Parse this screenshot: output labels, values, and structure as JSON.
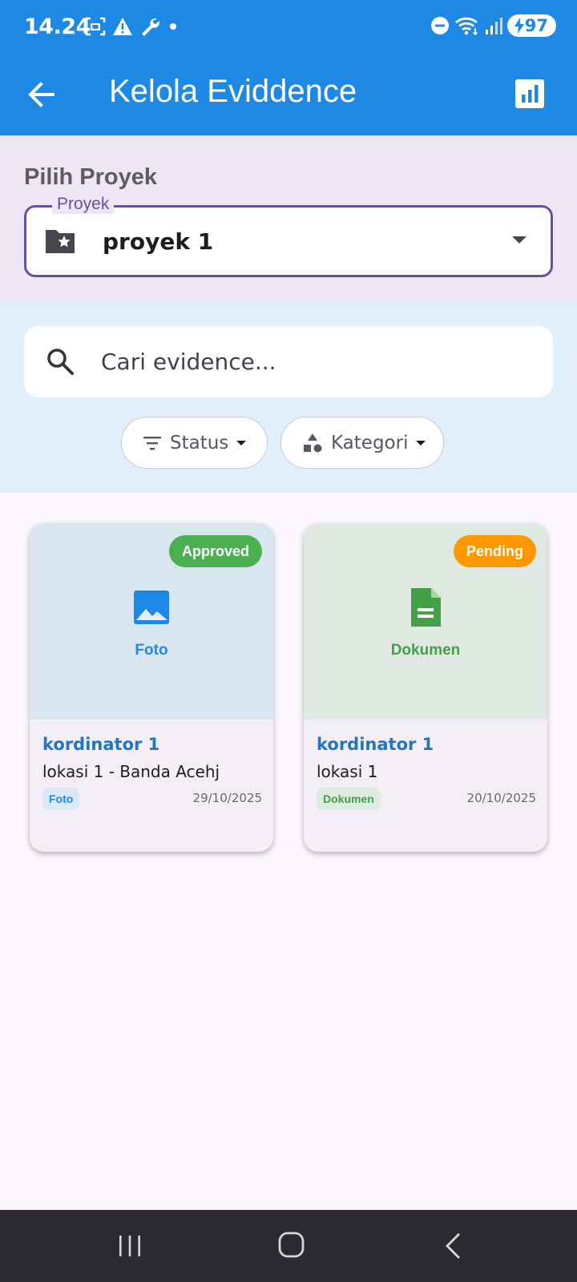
{
  "status_bar": {
    "time": "14.24",
    "battery": "97"
  },
  "app_bar": {
    "title": "Kelola Eviddence"
  },
  "project": {
    "heading": "Pilih Proyek",
    "field_label": "Proyek",
    "selected": "proyek 1"
  },
  "search": {
    "placeholder": "Cari evidence..."
  },
  "filters": {
    "status_label": "Status",
    "kategori_label": "Kategori"
  },
  "cards": [
    {
      "status": "Approved",
      "status_color": "#4caf50",
      "type_icon": "image-icon",
      "type_label": "Foto",
      "coordinator": "kordinator 1",
      "location": "lokasi 1 - Banda Acehj",
      "category": "Foto",
      "date": "29/10/2025"
    },
    {
      "status": "Pending",
      "status_color": "#ff9800",
      "type_icon": "document-icon",
      "type_label": "Dokumen",
      "coordinator": "kordinator 1",
      "location": "lokasi 1",
      "category": "Dokumen",
      "date": "20/10/2025"
    }
  ],
  "colors": {
    "primary": "#1e88e5",
    "outline": "#6750a4"
  }
}
